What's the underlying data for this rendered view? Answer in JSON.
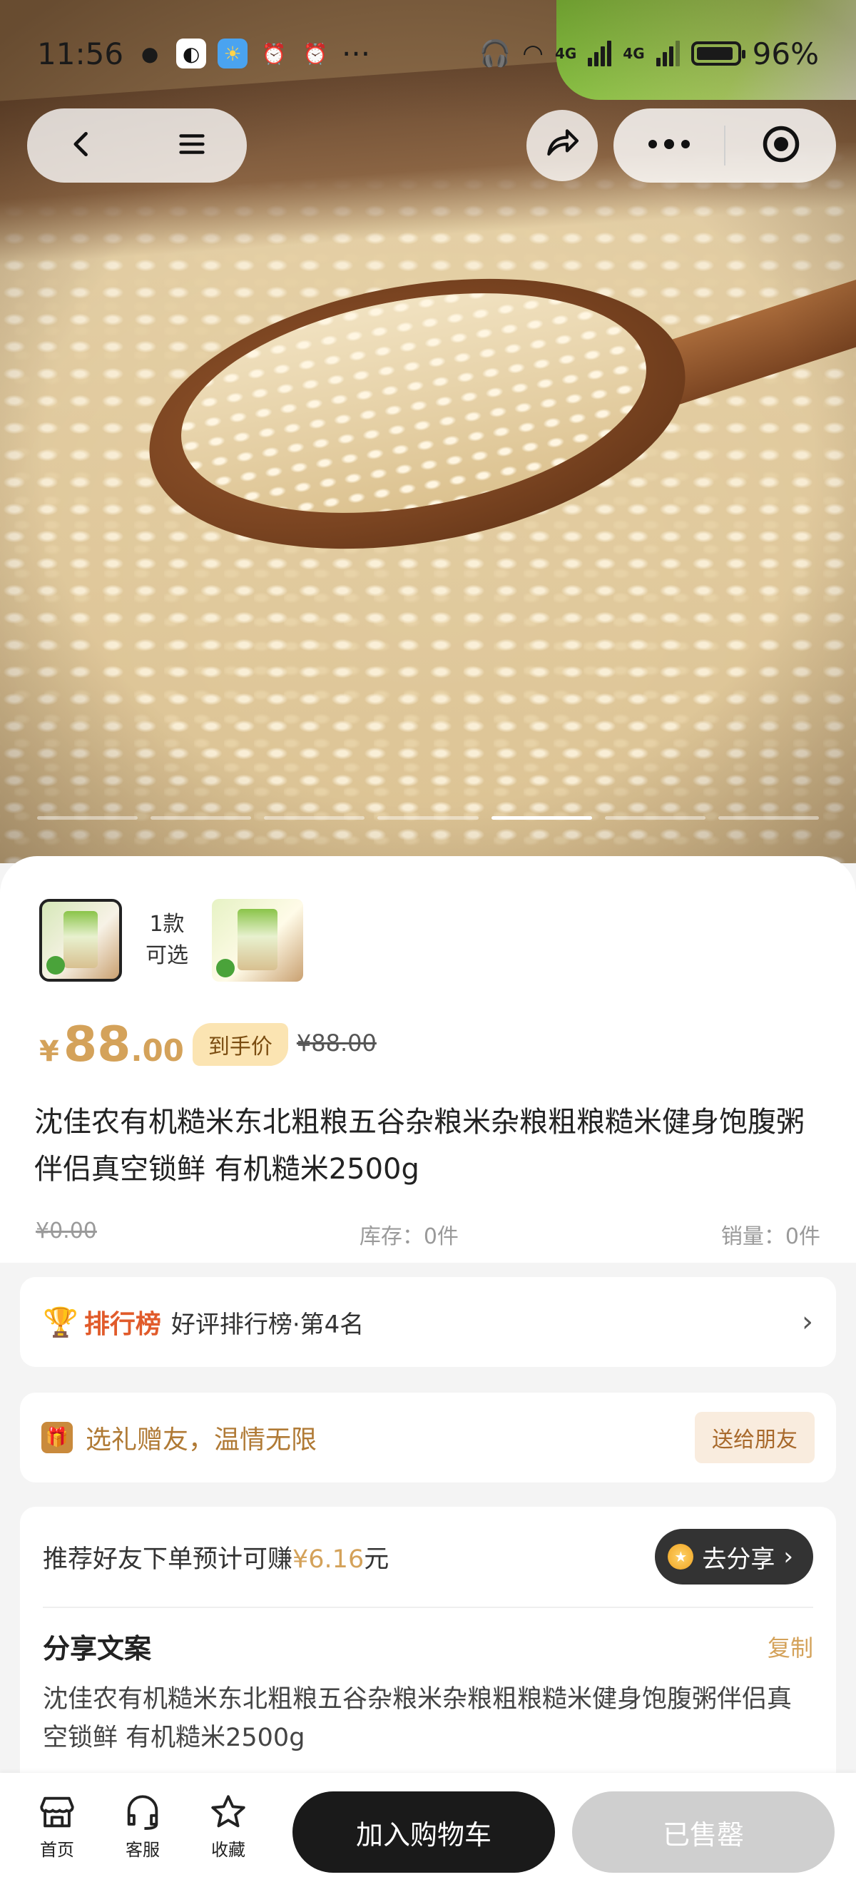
{
  "status_bar": {
    "time": "11:56",
    "network_labels": [
      "4G",
      "4G"
    ],
    "battery": "96%"
  },
  "hero": {
    "slide_count": 7,
    "active_slide": 5
  },
  "variants": {
    "count_text_line1": "1款",
    "count_text_line2": "可选"
  },
  "price": {
    "currency": "¥",
    "integer": "88",
    "decimal": ".00",
    "tag": "到手价",
    "original": "¥88.00"
  },
  "product": {
    "title": "沈佳农有机糙米东北粗粮五谷杂粮米杂粮粗粮糙米健身饱腹粥伴侣真空锁鲜 有机糙米2500g"
  },
  "stats": {
    "old_price": "¥0.00",
    "stock": "库存：0件",
    "sales": "销量：0件"
  },
  "ranking": {
    "brand": "排行榜",
    "text": "好评排行榜·第4名"
  },
  "gift": {
    "text": "选礼赠友，温情无限",
    "button": "送给朋友"
  },
  "share": {
    "prefix": "推荐好友下单预计可赚",
    "amount": "¥6.16",
    "suffix": "元",
    "button": "去分享",
    "section_label": "分享文案",
    "copy_label": "复制",
    "copy_text": "沈佳农有机糙米东北粗粮五谷杂粮米杂粮粗粮糙米健身饱腹粥伴侣真空锁鲜 有机糙米2500g"
  },
  "bottom_bar": {
    "home": "首页",
    "service": "客服",
    "favorite": "收藏",
    "add_to_cart": "加入购物车",
    "sold_out": "已售罄"
  },
  "colors": {
    "accent_gold": "#d4a25a",
    "rank_red": "#e15b2b",
    "dark_button": "#1a1a1a",
    "disabled_button": "#cfcfcf"
  }
}
